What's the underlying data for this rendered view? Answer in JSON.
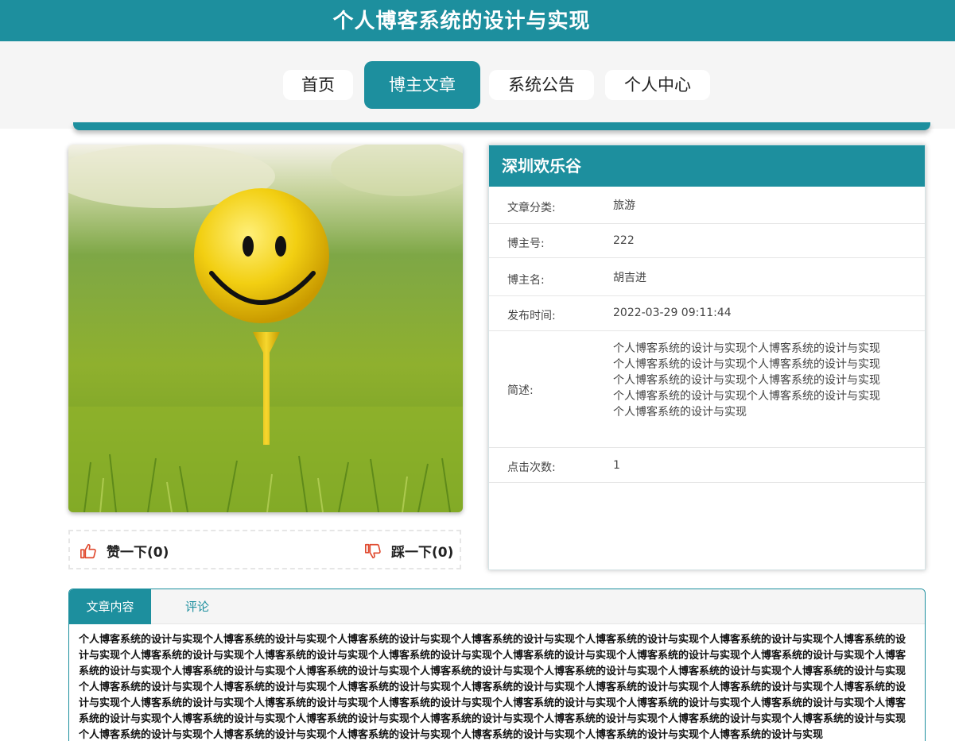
{
  "header": {
    "site_title": "个人博客系统的设计与实现"
  },
  "nav": {
    "items": [
      "首页",
      "博主文章",
      "系统公告",
      "个人中心"
    ],
    "active_index": 1
  },
  "votes": {
    "like_label": "赞一下(0)",
    "dislike_label": "踩一下(0)"
  },
  "article": {
    "title": "深圳欢乐谷",
    "fields": [
      {
        "label": "文章分类:",
        "value": "旅游"
      },
      {
        "label": "博主号:",
        "value": "222"
      },
      {
        "label": "博主名:",
        "value": "胡吉进"
      },
      {
        "label": "发布时间:",
        "value": "2022-03-29 09:11:44"
      },
      {
        "label": "简述:",
        "value": "个人博客系统的设计与实现个人博客系统的设计与实现个人博客系统的设计与实现个人博客系统的设计与实现个人博客系统的设计与实现个人博客系统的设计与实现个人博客系统的设计与实现个人博客系统的设计与实现个人博客系统的设计与实现"
      },
      {
        "label": "点击次数:",
        "value": "1"
      }
    ]
  },
  "tabs": {
    "items": [
      "文章内容",
      "评论"
    ],
    "active_index": 0
  },
  "content": {
    "text": "个人博客系统的设计与实现个人博客系统的设计与实现个人博客系统的设计与实现个人博客系统的设计与实现个人博客系统的设计与实现个人博客系统的设计与实现个人博客系统的设计与实现个人博客系统的设计与实现个人博客系统的设计与实现个人博客系统的设计与实现个人博客系统的设计与实现个人博客系统的设计与实现个人博客系统的设计与实现个人博客系统的设计与实现个人博客系统的设计与实现个人博客系统的设计与实现个人博客系统的设计与实现个人博客系统的设计与实现个人博客系统的设计与实现个人博客系统的设计与实现个人博客系统的设计与实现个人博客系统的设计与实现个人博客系统的设计与实现个人博客系统的设计与实现个人博客系统的设计与实现个人博客系统的设计与实现个人博客系统的设计与实现个人博客系统的设计与实现个人博客系统的设计与实现个人博客系统的设计与实现个人博客系统的设计与实现个人博客系统的设计与实现个人博客系统的设计与实现个人博客系统的设计与实现个人博客系统的设计与实现个人博客系统的设计与实现个人博客系统的设计与实现个人博客系统的设计与实现个人博客系统的设计与实现个人博客系统的设计与实现个人博客系统的设计与实现个人博客系统的设计与实现个人博客系统的设计与实现个人博客系统的设计与实现个人博客系统的设计与实现个人博客系统的设计与实现"
  },
  "colors": {
    "primary": "#1d8f9e",
    "nav_bg": "#f5f5f5",
    "like_icon": "#e04a2f",
    "dislike_icon": "#e04a2f"
  },
  "image": {
    "subject": "smiley-golf-ball-on-tee"
  }
}
